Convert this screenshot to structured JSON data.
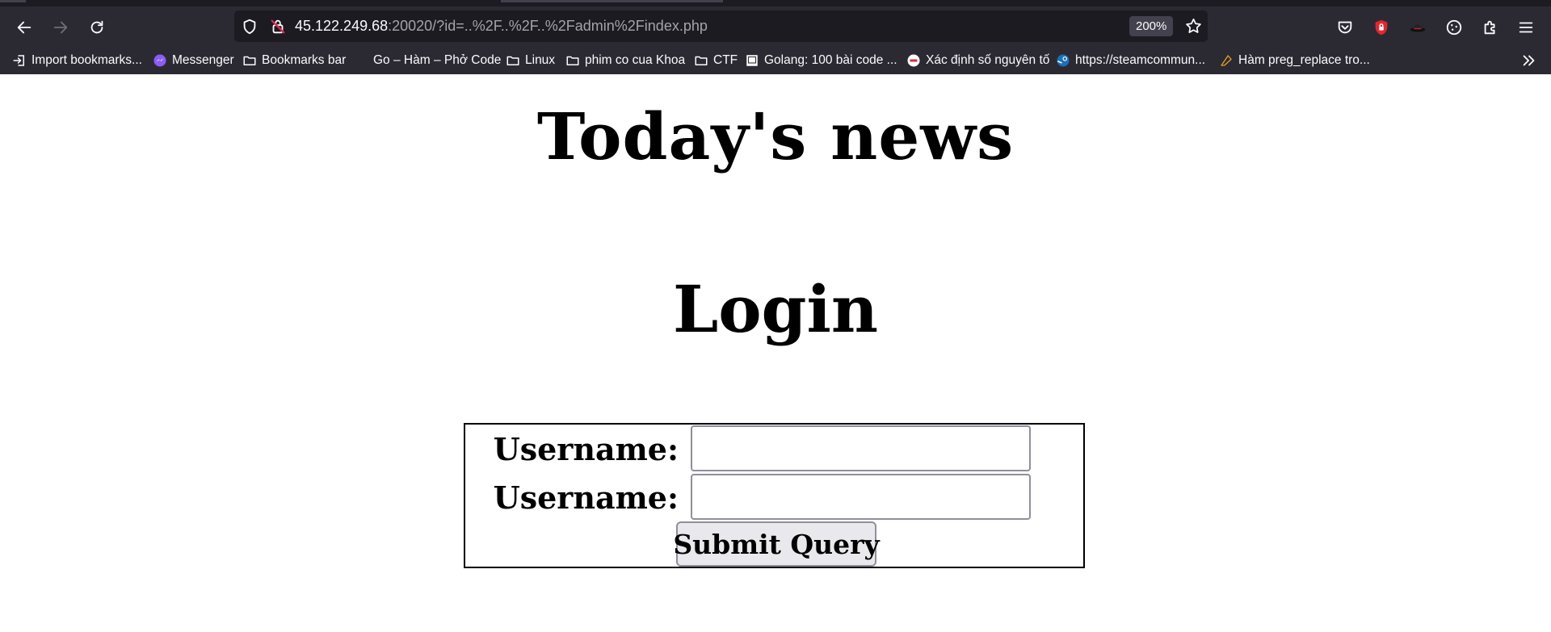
{
  "browser": {
    "url_host": "45.122.249.68",
    "url_rest": ":20020/?id=..%2F..%2F..%2Fadmin%2Findex.php",
    "zoom": "200%",
    "bookmarks": [
      {
        "icon": "import-icon",
        "label": "Import bookmarks..."
      },
      {
        "icon": "messenger-icon",
        "label": "Messenger"
      },
      {
        "icon": "folder-icon",
        "label": "Bookmarks bar"
      },
      {
        "icon": "go-icon",
        "label": "Go – Hàm – Phở Code"
      },
      {
        "icon": "folder-icon",
        "label": "Linux"
      },
      {
        "icon": "folder-icon",
        "label": "phim co cua Khoa"
      },
      {
        "icon": "folder-icon",
        "label": "CTF"
      },
      {
        "icon": "page-icon",
        "label": "Golang: 100 bài code ..."
      },
      {
        "icon": "site-icon",
        "label": "Xác định số nguyên tố"
      },
      {
        "icon": "steam-icon",
        "label": "https://steamcommun..."
      },
      {
        "icon": "php-icon",
        "label": "Hàm preg_replace tro..."
      }
    ]
  },
  "page": {
    "heading_news": "Today's news",
    "heading_login": "Login",
    "form": {
      "username_label_1": "Username:",
      "username_label_2": "Username:",
      "username_value_1": "",
      "username_value_2": "",
      "submit_label": "Submit Query"
    }
  },
  "colors": {
    "chrome_bg": "#2b2a33",
    "urlbar_bg": "#1c1b22",
    "page_bg": "#ffffff",
    "button_bg": "#e9e9ed"
  }
}
